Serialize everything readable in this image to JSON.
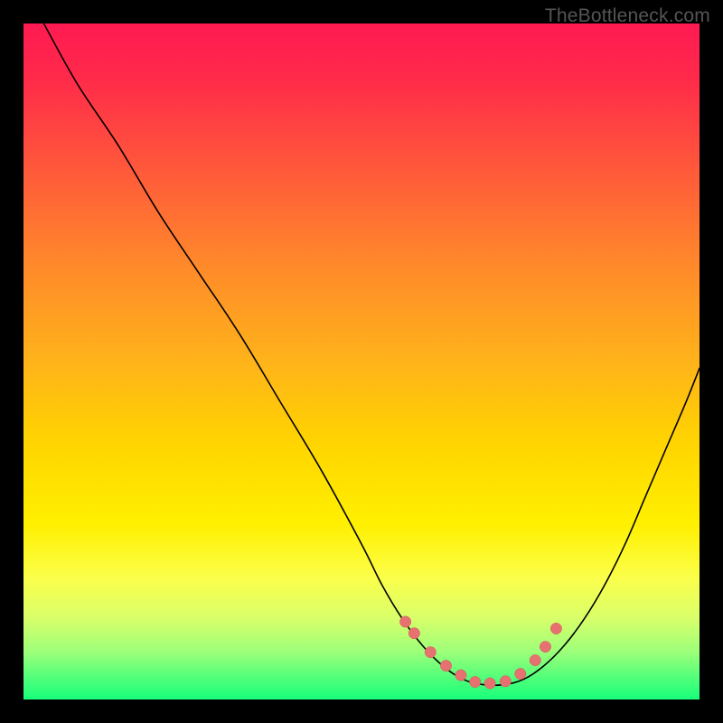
{
  "watermark": "TheBottleneck.com",
  "colors": {
    "dot_fill": "#e77070",
    "dot_stroke": "#d45a5a",
    "curve": "#000000"
  },
  "chart_data": {
    "type": "line",
    "title": "",
    "xlabel": "",
    "ylabel": "",
    "xlim": [
      0,
      100
    ],
    "ylim": [
      0,
      100
    ],
    "series": [
      {
        "name": "bottleneck-curve",
        "x": [
          3,
          8,
          14,
          20,
          26,
          32,
          38,
          44,
          50,
          53,
          56,
          59,
          62,
          65,
          68,
          71,
          74,
          77,
          80,
          83,
          86,
          89,
          92,
          95,
          98,
          100
        ],
        "y": [
          100,
          91,
          82,
          72,
          63,
          54,
          44,
          34,
          23,
          17,
          12,
          8,
          5,
          3,
          2.2,
          2.2,
          3,
          5,
          8,
          12,
          17,
          23,
          30,
          37,
          44,
          49
        ]
      }
    ],
    "markers": {
      "name": "highlight-dots",
      "x": [
        56.5,
        57.8,
        60.2,
        62.5,
        64.7,
        66.8,
        69.0,
        71.3,
        73.5,
        75.7,
        77.2,
        78.8
      ],
      "y": [
        11.5,
        9.8,
        7.0,
        5.0,
        3.6,
        2.6,
        2.4,
        2.7,
        3.8,
        5.8,
        7.8,
        10.5
      ]
    }
  }
}
